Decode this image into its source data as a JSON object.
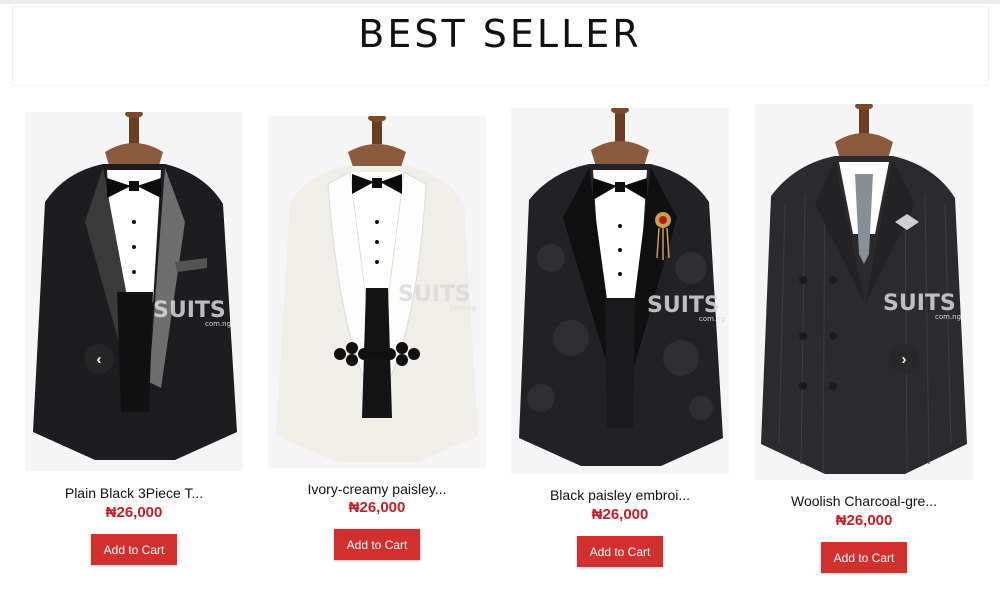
{
  "section": {
    "title": "BEST SELLER"
  },
  "watermark": {
    "brand": "SUITS",
    "domain": "com.ng"
  },
  "products": [
    {
      "name": "Plain Black 3Piece T...",
      "price": "₦26,000",
      "cta": "Add to Cart"
    },
    {
      "name": "Ivory-creamy paisley...",
      "price": "₦26,000",
      "cta": "Add to Cart"
    },
    {
      "name": "Black paisley embroi...",
      "price": "₦26,000",
      "cta": "Add to Cart"
    },
    {
      "name": "Woolish Charcoal-gre...",
      "price": "₦26,000",
      "cta": "Add to Cart"
    }
  ],
  "carousel": {
    "prev_icon": "chevron-left-icon",
    "next_icon": "chevron-right-icon",
    "prev_glyph": "‹",
    "next_glyph": "›"
  },
  "colors": {
    "price": "#c81d24",
    "button": "#d22f2f"
  }
}
